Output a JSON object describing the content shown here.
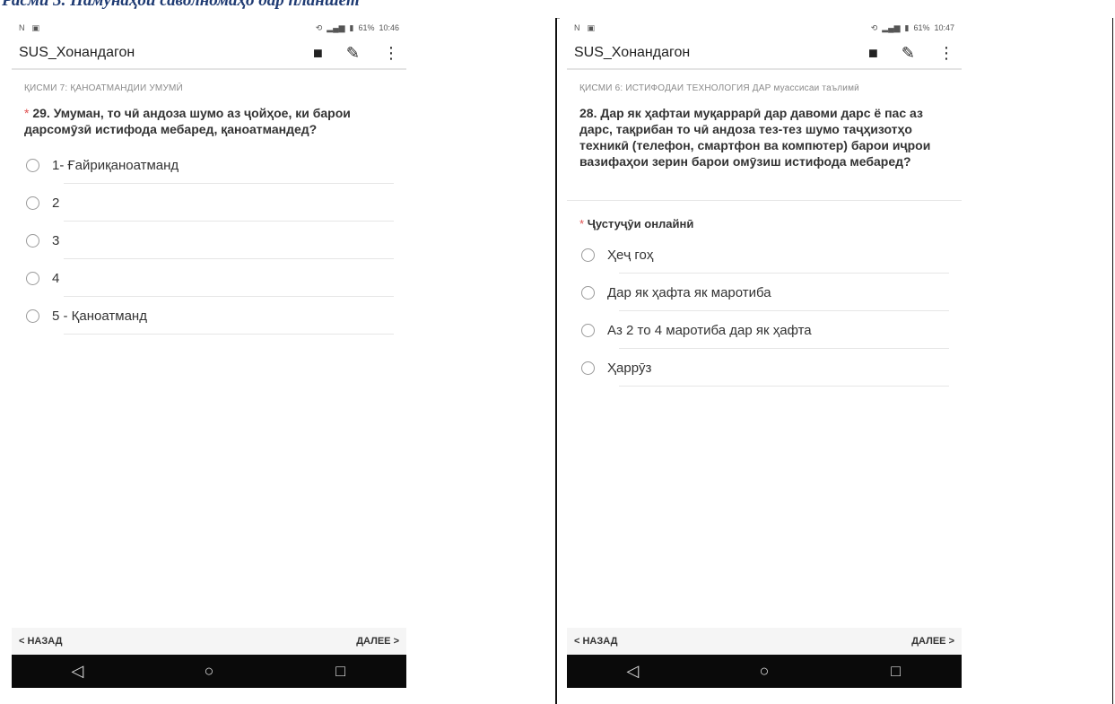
{
  "caption": "Расми 3. Намунаҳои саволномаҳо дар планшет",
  "left_screen": {
    "app_title": "SUS_Хонандагон",
    "status_time": "10:46",
    "status_battery": "61%",
    "section": "ҚИСМИ 7: ҚАНОАТМАНДИИ УМУМӢ",
    "question_required": "*",
    "question": "29. Умуман, то чӣ андоза шумо аз ҷойҳое, ки барои дарсомӯзӣ истифода мебаред, қаноатмандед?",
    "options": [
      "1- Ғайриқаноатманд",
      "2",
      "3",
      "4",
      "5 - Қаноатманд"
    ],
    "back_label": "< НАЗАД",
    "next_label": "ДАЛЕЕ >"
  },
  "right_screen": {
    "app_title": "SUS_Хонандагон",
    "status_time": "10:47",
    "status_battery": "61%",
    "section": "ҚИСМИ 6: ИСТИФОДАИ ТЕХНОЛОГИЯ ДАР муассисаи таълимӣ",
    "question": "28. Дар як ҳафтаи муқаррарӣ дар давоми дарс ё пас аз дарс, тақрибан то чӣ андоза тез-тез шумо таҷҳизотҳо техникӣ (телефон, смартфон ва компютер) барои иҷрои вазифаҳои зерин барои омӯзиш истифода мебаред?",
    "sub_required": "*",
    "sub_question": "Ҷустуҷӯи онлайнӣ",
    "options": [
      "Ҳеҷ гоҳ",
      "Дар як ҳафта як маротиба",
      "Аз 2 то 4 маротиба дар як ҳафта",
      "Ҳаррӯз"
    ],
    "back_label": "< НАЗАД",
    "next_label": "ДАЛЕЕ >"
  },
  "icons": {
    "save": "save-icon",
    "edit": "pen-icon",
    "menu": "more-vert-icon",
    "back": "triangle-back-icon",
    "home": "circle-home-icon",
    "recents": "square-recents-icon"
  }
}
